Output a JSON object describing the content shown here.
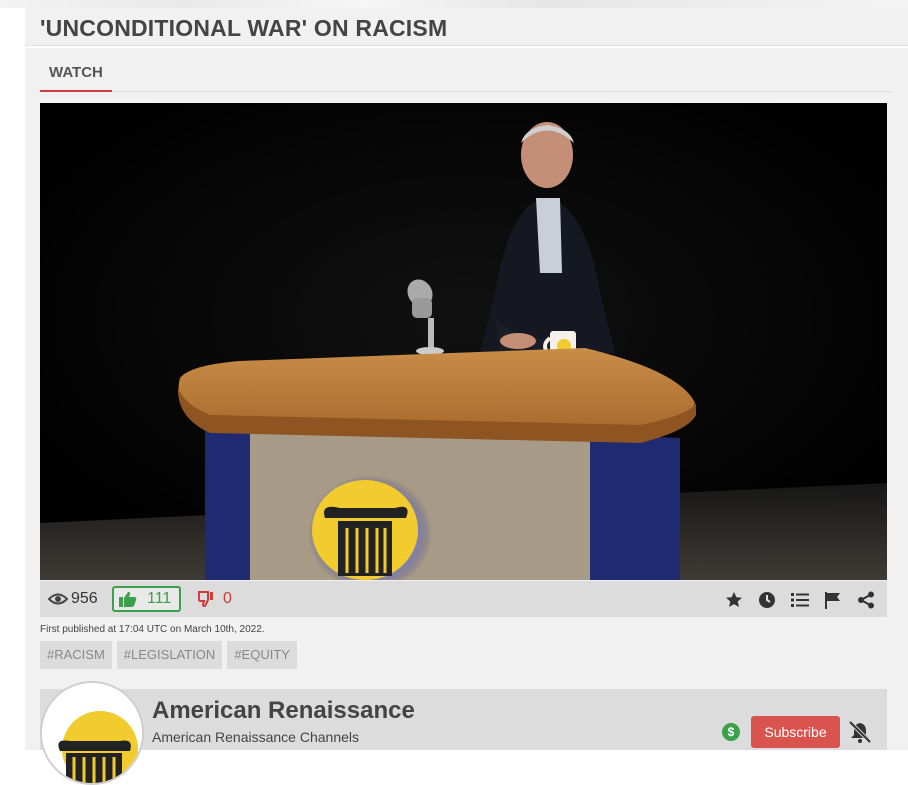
{
  "page": {
    "title": "'UNCONDITIONAL WAR' ON RACISM"
  },
  "tabs": [
    {
      "label": "WATCH"
    }
  ],
  "stats": {
    "views": "956",
    "likes": "111",
    "dislikes": "0"
  },
  "actions": [
    {
      "icon": "star-icon"
    },
    {
      "icon": "clock-icon"
    },
    {
      "icon": "list-icon"
    },
    {
      "icon": "flag-icon"
    },
    {
      "icon": "share-icon"
    }
  ],
  "published": "First published at 17:04 UTC on March 10th, 2022.",
  "tags": [
    "#RACISM",
    "#LEGISLATION",
    "#EQUITY"
  ],
  "channel": {
    "name": "American Renaissance",
    "subtitle": "American Renaissance Channels",
    "subscribe_label": "Subscribe",
    "tip_symbol": "$"
  },
  "colors": {
    "accent_red": "#d9534f",
    "like_green": "#3ca04a",
    "logo_yellow": "#f2cc2f"
  }
}
